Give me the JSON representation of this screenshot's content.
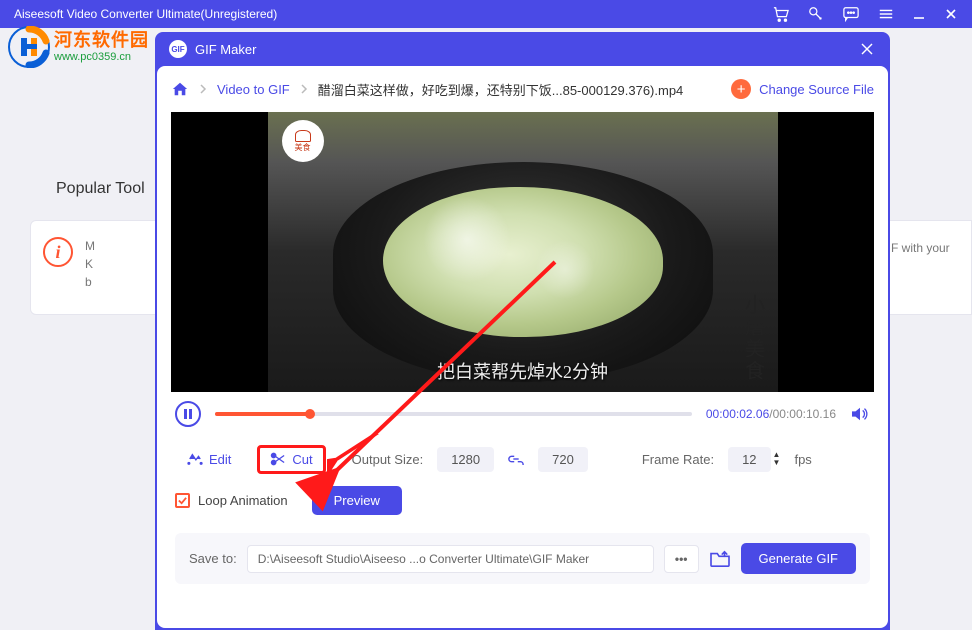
{
  "titlebar": {
    "text": "Aiseesoft Video Converter Ultimate(Unregistered)"
  },
  "watermark": {
    "cn": "河东软件园",
    "url": "www.pc0359.cn"
  },
  "background": {
    "popular": "Popular Tool",
    "card_left_line1": "M",
    "card_left_line2": "K",
    "card_left_line3": "b",
    "card_right": "F with your"
  },
  "dialog": {
    "title": "GIF Maker",
    "breadcrumb": {
      "root": "Video to GIF",
      "file": "醋溜白菜这样做，好吃到爆，还特别下饭...85-000129.376).mp4",
      "change": "Change Source File"
    },
    "video": {
      "chef_badge": "美食",
      "side_text": "小屠美食",
      "subtitle": "把白菜帮先焯水2分钟"
    },
    "player": {
      "current": "00:00:02.06",
      "duration": "00:00:10.16"
    },
    "tools": {
      "edit": "Edit",
      "cut": "Cut",
      "output_size": "Output Size:",
      "width": "1280",
      "height": "720",
      "frame_rate": "Frame Rate:",
      "fps_value": "12",
      "fps_unit": "fps"
    },
    "loop": {
      "label": "Loop Animation",
      "preview": "Preview"
    },
    "save": {
      "label": "Save to:",
      "path": "D:\\Aiseesoft Studio\\Aiseeso ...o Converter Ultimate\\GIF Maker",
      "dots": "•••",
      "generate": "Generate GIF"
    }
  }
}
